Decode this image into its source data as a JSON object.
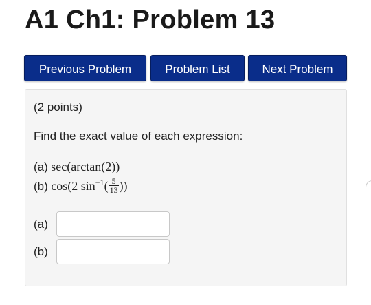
{
  "page": {
    "title": "A1 Ch1: Problem 13"
  },
  "nav": {
    "previous_label": "Previous Problem",
    "list_label": "Problem List",
    "next_label": "Next Problem"
  },
  "problem": {
    "points": "(2 points)",
    "instruction": "Find the exact value of each expression:",
    "expressions": [
      {
        "label": "(a)",
        "text": "sec(arctan(2))"
      },
      {
        "label": "(b)",
        "func": "cos(2 sin",
        "exponent": "−1",
        "paren_open": "(",
        "numerator": "5",
        "denominator": "13",
        "close": "))"
      }
    ],
    "answers": [
      {
        "label": "(a)",
        "value": ""
      },
      {
        "label": "(b)",
        "value": ""
      }
    ]
  },
  "colors": {
    "button_bg": "#0a2d8a",
    "button_text": "#ffffff",
    "panel_bg": "#f5f5f5"
  }
}
